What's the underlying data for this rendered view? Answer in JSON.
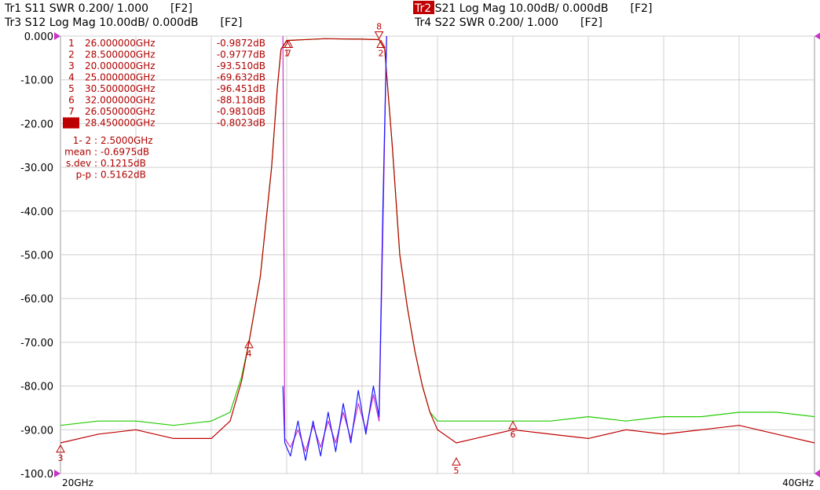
{
  "header": {
    "tr1": {
      "id": "Tr1",
      "label": "S11 SWR 0.200/ 1.000",
      "tag": "[F2]",
      "color": "#1a1aff"
    },
    "tr2": {
      "id": "Tr2",
      "label": "S21 Log Mag 10.00dB/ 0.000dB",
      "tag": "[F2]",
      "color": "#c00000"
    },
    "tr3": {
      "id": "Tr3",
      "label": "S12 Log Mag 10.00dB/ 0.000dB",
      "tag": "[F2]",
      "color": "#22cc00"
    },
    "tr4": {
      "id": "Tr4",
      "label": "S22 SWR 0.200/ 1.000",
      "tag": "[F2]",
      "color": "#cc33cc"
    }
  },
  "marker_table": [
    {
      "n": "1",
      "freq": "26.000000GHz",
      "value": "-0.9872dB"
    },
    {
      "n": "2",
      "freq": "28.500000GHz",
      "value": "-0.9777dB"
    },
    {
      "n": "3",
      "freq": "20.000000GHz",
      "value": "-93.510dB"
    },
    {
      "n": "4",
      "freq": "25.000000GHz",
      "value": "-69.632dB"
    },
    {
      "n": "5",
      "freq": "30.500000GHz",
      "value": "-96.451dB"
    },
    {
      "n": "6",
      "freq": "32.000000GHz",
      "value": "-88.118dB"
    },
    {
      "n": "7",
      "freq": "26.050000GHz",
      "value": "-0.9810dB"
    },
    {
      "n": "8",
      "freq": "28.450000GHz",
      "value": "-0.8023dB",
      "active": true
    }
  ],
  "stats": [
    {
      "label": "1- 2 :",
      "value": "2.5000GHz"
    },
    {
      "label": "mean :",
      "value": "-0.6975dB"
    },
    {
      "label": "s.dev :",
      "value": "0.1215dB"
    },
    {
      "label": "p-p :",
      "value": "0.5162dB"
    }
  ],
  "chart_data": {
    "type": "line",
    "xlim": [
      20,
      40
    ],
    "ylim": [
      -100,
      0
    ],
    "x_unit": "GHz",
    "xtick_labels": [
      "20GHz",
      "40GHz"
    ],
    "yticks": [
      0,
      -10,
      -20,
      -30,
      -40,
      -50,
      -60,
      -70,
      -80,
      -90,
      -100
    ],
    "ytick_labels": [
      "0.000",
      "-10.00",
      "-20.00",
      "-30.00",
      "-40.00",
      "-50.00",
      "-60.00",
      "-70.00",
      "-80.00",
      "-90.00",
      "-100.0"
    ],
    "grid": true,
    "series": [
      {
        "name": "S21",
        "color": "#c00000",
        "x": [
          20,
          21,
          22,
          23,
          24,
          24.5,
          24.8,
          25,
          25.3,
          25.6,
          25.75,
          25.85,
          26,
          27,
          28,
          28.45,
          28.6,
          28.8,
          29,
          29.2,
          29.4,
          29.6,
          29.8,
          30,
          30.5,
          31,
          32,
          33,
          34,
          35,
          36,
          37,
          38,
          39,
          40
        ],
        "y": [
          -93,
          -91,
          -90,
          -92,
          -92,
          -88,
          -79,
          -70,
          -55,
          -30,
          -12,
          -3,
          -1,
          -0.6,
          -0.7,
          -0.8,
          -3,
          -25,
          -50,
          -62,
          -72,
          -80,
          -86,
          -90,
          -93,
          -92,
          -90,
          -91,
          -92,
          -90,
          -91,
          -90,
          -89,
          -91,
          -93
        ]
      },
      {
        "name": "S12",
        "color": "#22cc00",
        "x": [
          20,
          21,
          22,
          23,
          24,
          24.5,
          24.8,
          25,
          25.3,
          25.6,
          25.75,
          25.85,
          26,
          27,
          28,
          28.45,
          28.6,
          28.8,
          29,
          29.2,
          29.4,
          29.6,
          29.8,
          30,
          30.5,
          31,
          32,
          33,
          34,
          35,
          36,
          37,
          38,
          39,
          40
        ],
        "y": [
          -89,
          -88,
          -88,
          -89,
          -88,
          -86,
          -78,
          -70,
          -55,
          -30,
          -12,
          -3,
          -1,
          -0.6,
          -0.7,
          -0.8,
          -3,
          -25,
          -50,
          -62,
          -72,
          -80,
          -86,
          -88,
          -88,
          -88,
          -88,
          -88,
          -87,
          -88,
          -87,
          -87,
          -86,
          -86,
          -87
        ]
      },
      {
        "name": "S11",
        "color": "#1a1aff",
        "x": [
          25.9,
          25.95,
          26.1,
          26.3,
          26.5,
          26.7,
          26.9,
          27.1,
          27.3,
          27.5,
          27.7,
          27.9,
          28.1,
          28.3,
          28.45,
          28.55,
          28.65
        ],
        "y": [
          -80,
          -93,
          -96,
          -88,
          -97,
          -88,
          -96,
          -86,
          -95,
          -84,
          -93,
          -81,
          -91,
          -80,
          -87,
          -40,
          0
        ]
      },
      {
        "name": "S22",
        "color": "#cc33cc",
        "x": [
          25.9,
          25.95,
          26.1,
          26.3,
          26.5,
          26.7,
          26.9,
          27.1,
          27.3,
          27.5,
          27.7,
          27.9,
          28.1,
          28.3,
          28.45,
          28.55,
          28.65
        ],
        "y": [
          0,
          -92,
          -94,
          -90,
          -95,
          -89,
          -94,
          -88,
          -93,
          -86,
          -92,
          -84,
          -90,
          -82,
          -88,
          -45,
          0
        ]
      }
    ],
    "markers": [
      {
        "n": "1",
        "x": 26.0,
        "y": -0.9872
      },
      {
        "n": "2",
        "x": 28.5,
        "y": -0.9777
      },
      {
        "n": "3",
        "x": 20.0,
        "y": -93.51
      },
      {
        "n": "4",
        "x": 25.0,
        "y": -69.632
      },
      {
        "n": "5",
        "x": 30.5,
        "y": -96.451
      },
      {
        "n": "6",
        "x": 32.0,
        "y": -88.118
      },
      {
        "n": "7",
        "x": 26.05,
        "y": -0.981
      },
      {
        "n": "8",
        "x": 28.45,
        "y": -0.8023
      }
    ]
  }
}
